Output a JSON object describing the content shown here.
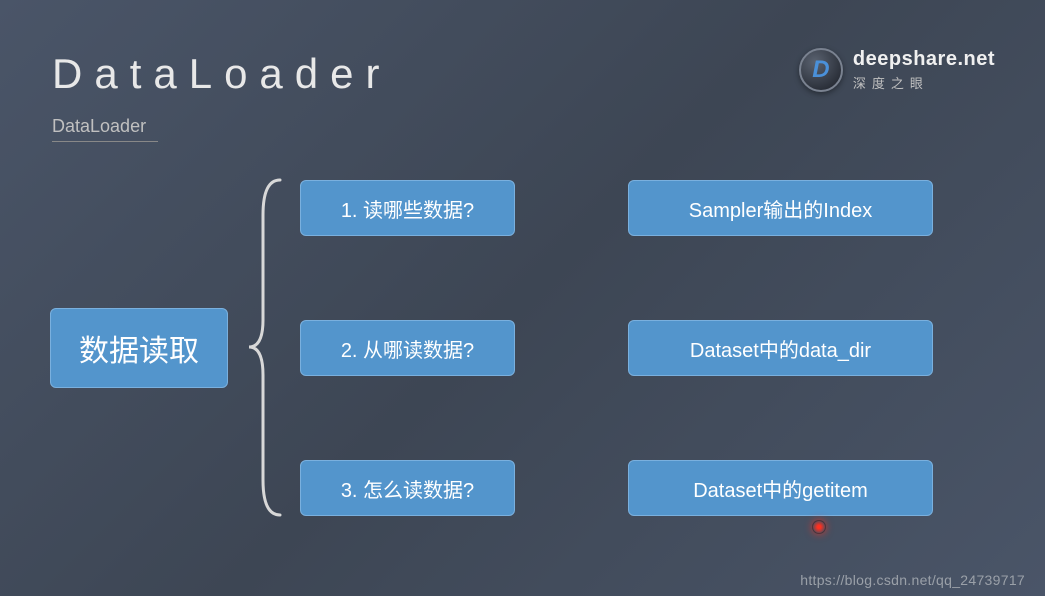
{
  "header": {
    "title": "DataLoader",
    "subtitle": "DataLoader"
  },
  "logo": {
    "brand": "deepshare.net",
    "tagline": "深度之眼",
    "letter": "D"
  },
  "diagram": {
    "root": "数据读取",
    "rows": [
      {
        "question": "1. 读哪些数据?",
        "answer": "Sampler输出的Index"
      },
      {
        "question": "2. 从哪读数据?",
        "answer": "Dataset中的data_dir"
      },
      {
        "question": "3. 怎么读数据?",
        "answer": "Dataset中的getitem"
      }
    ]
  },
  "watermark": "https://blog.csdn.net/qq_24739717"
}
